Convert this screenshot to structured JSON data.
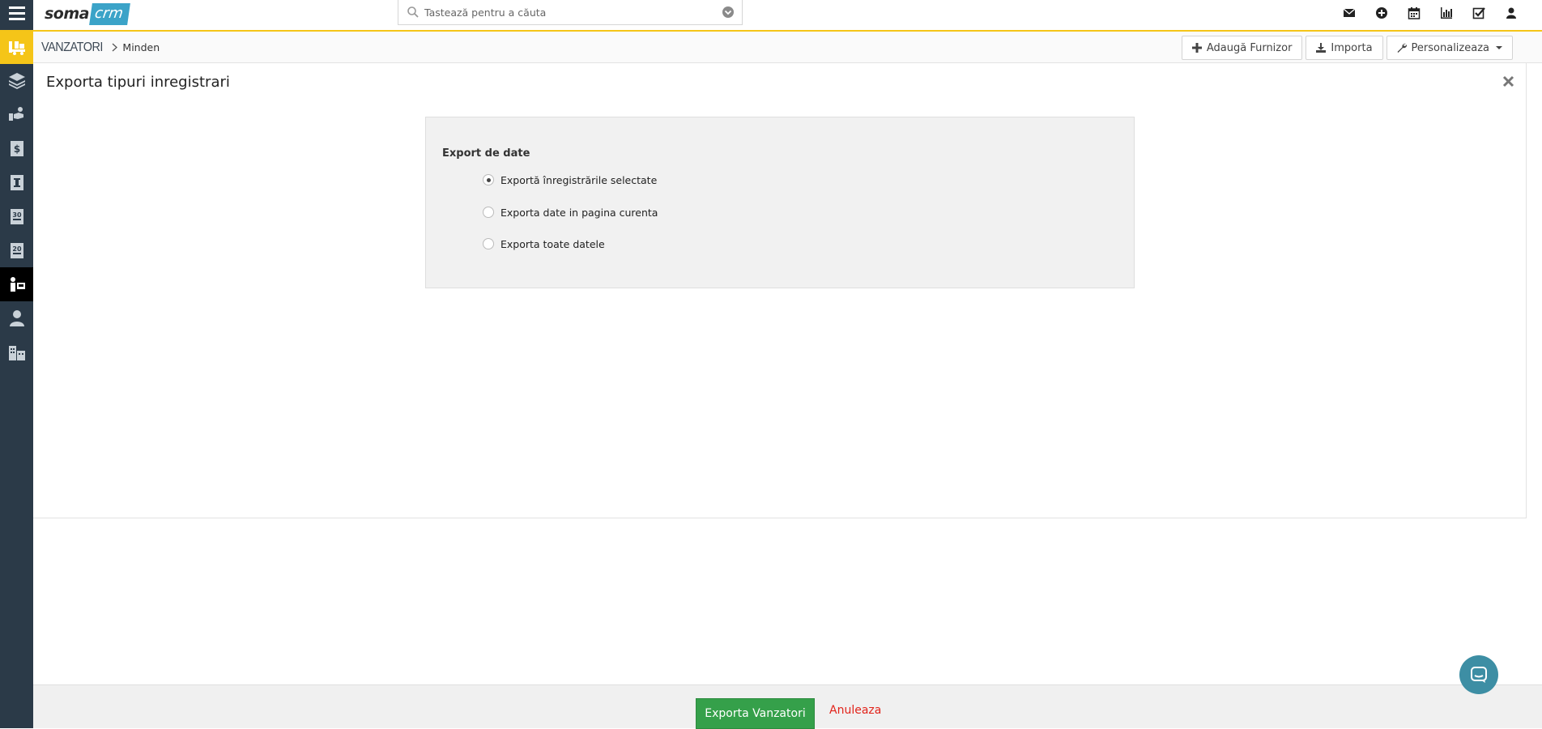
{
  "app": {
    "logo_left": "soma",
    "logo_right": "crm"
  },
  "search": {
    "placeholder": "Tastează pentru a căuta"
  },
  "breadcrumb": {
    "module": "VANZATORI",
    "view": "Minden"
  },
  "actions": {
    "add_label": "Adaugă Furnizor",
    "import_label": "Importa",
    "customize_label": "Personalizeaza"
  },
  "panel": {
    "title": "Exporta tipuri inregistrari"
  },
  "export": {
    "section_label": "Export de date",
    "options": [
      {
        "label": "Exportă înregistrările selectate",
        "selected": true
      },
      {
        "label": "Exporta date in pagina curenta",
        "selected": false
      },
      {
        "label": "Exporta toate datele",
        "selected": false
      }
    ]
  },
  "footer": {
    "export_button": "Exporta Vanzatori",
    "cancel_link": "Anuleaza"
  },
  "colors": {
    "sidebar_bg": "#2b3a48",
    "active_yellow": "#f5c518",
    "export_green": "#35a04a",
    "cancel_red": "#e2231a",
    "logo_blue": "#3ba3c8",
    "chat_teal": "#3d8ea4"
  },
  "icons": {
    "sidebar": [
      "menu-icon",
      "suppliers-icon",
      "layers-icon",
      "hand-icon",
      "invoice-icon",
      "document-icon",
      "document-30-icon",
      "document-20-icon",
      "vendor-icon",
      "person-icon",
      "building-icon"
    ],
    "top": [
      "mail-icon",
      "plus-circle-icon",
      "calendar-icon",
      "bar-chart-icon",
      "checkbox-icon",
      "user-icon"
    ]
  }
}
